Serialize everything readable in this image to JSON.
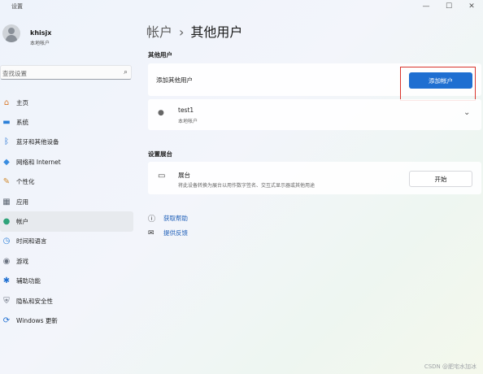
{
  "window": {
    "app_title": "设置",
    "controls": {
      "minimize": "—",
      "maximize": "☐",
      "close": "✕"
    }
  },
  "user": {
    "name": "khisjx",
    "account_type": "本地帐户"
  },
  "search": {
    "placeholder": "查找设置",
    "icon": "search-icon"
  },
  "sidebar": {
    "items": [
      {
        "label": "主页",
        "icon": "home-icon",
        "glyph": "⌂",
        "color": "#d97a2b"
      },
      {
        "label": "系统",
        "icon": "system-icon",
        "glyph": "▬",
        "color": "#2b7fd8"
      },
      {
        "label": "蓝牙和其他设备",
        "icon": "bluetooth-icon",
        "glyph": "ᛒ",
        "color": "#1f6fd1"
      },
      {
        "label": "网络和 Internet",
        "icon": "network-icon",
        "glyph": "◆",
        "color": "#3a8de0"
      },
      {
        "label": "个性化",
        "icon": "brush-icon",
        "glyph": "✎",
        "color": "#d08a2e"
      },
      {
        "label": "应用",
        "icon": "apps-icon",
        "glyph": "▦",
        "color": "#5b6470"
      },
      {
        "label": "帐户",
        "icon": "account-icon",
        "glyph": "●",
        "color": "#2fa37a",
        "active": true
      },
      {
        "label": "时间和语言",
        "icon": "time-language-icon",
        "glyph": "◷",
        "color": "#2b7fd8"
      },
      {
        "label": "游戏",
        "icon": "gaming-icon",
        "glyph": "◉",
        "color": "#6b7280"
      },
      {
        "label": "辅助功能",
        "icon": "accessibility-icon",
        "glyph": "✱",
        "color": "#1f6fd1"
      },
      {
        "label": "隐私和安全性",
        "icon": "shield-icon",
        "glyph": "⛨",
        "color": "#6b7280"
      },
      {
        "label": "Windows 更新",
        "icon": "windows-update-icon",
        "glyph": "⟳",
        "color": "#1f6fd1"
      }
    ]
  },
  "breadcrumb": {
    "parent": "帐户",
    "separator": "›",
    "current": "其他用户"
  },
  "other_users": {
    "section_title": "其他用户",
    "add_label": "添加其他用户",
    "add_button": "添加帐户",
    "users": [
      {
        "name": "test1",
        "type": "本地帐户"
      }
    ]
  },
  "kiosk": {
    "section_title": "设置展台",
    "title": "展台",
    "description": "将此设备转换为展台以用作数字签名、交互式显示器或其他用途",
    "button": "开始"
  },
  "links": {
    "help": "获取帮助",
    "feedback": "提供反馈"
  },
  "watermark": "CSDN @肥宅水加冰",
  "colors": {
    "accent": "#1f6fd1",
    "highlight_box": "#d9342b"
  }
}
